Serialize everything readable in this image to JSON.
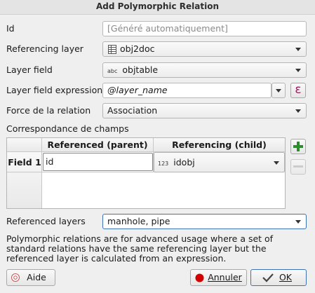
{
  "window": {
    "title": "Add Polymorphic Relation"
  },
  "form": {
    "id_label": "Id",
    "id_placeholder": "[Généré automatiquement]",
    "referencing_layer_label": "Referencing layer",
    "referencing_layer_value": "obj2doc",
    "layer_field_label": "Layer field",
    "layer_field_type": "abc",
    "layer_field_value": "objtable",
    "layer_field_expression_label": "Layer field expression",
    "layer_field_expression_value": "@layer_name",
    "relation_strength_label": "Force de la relation",
    "relation_strength_value": "Association",
    "field_mapping_label": "Correspondance de champs"
  },
  "mapping_table": {
    "col_parent": "Referenced (parent)",
    "col_child": "Referencing (child)",
    "rows": [
      {
        "header": "Field 1",
        "parent": "id",
        "child_type": "123",
        "child": "idobj"
      }
    ]
  },
  "referenced_layers": {
    "label": "Referenced layers",
    "value": "manhole, pipe"
  },
  "info_text": "Polymorphic relations are for advanced usage where a set of standard relations have the same referencing layer but the referenced layer is calculated from an expression.",
  "buttons": {
    "help": "Aide",
    "cancel": "Annuler",
    "ok": "OK"
  },
  "colors": {
    "add_icon": "#2e8b2e",
    "expression_icon": "#9a1b5b",
    "cancel_icon": "#d40000"
  }
}
